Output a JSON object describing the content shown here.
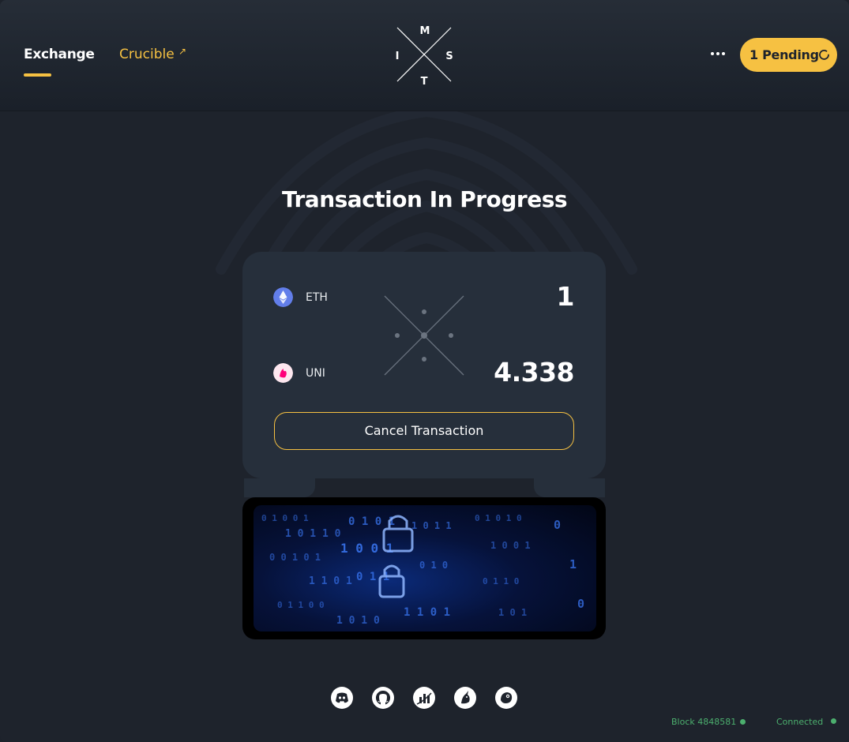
{
  "nav": {
    "exchange_label": "Exchange",
    "crucible_label": "Crucible",
    "crucible_ext_icon": "external-arrow-icon"
  },
  "logo": {
    "top": "M",
    "left": "I",
    "right": "S",
    "bottom": "T"
  },
  "header": {
    "more_icon": "ellipsis-icon",
    "pending_label": "1 Pending"
  },
  "main": {
    "title": "Transaction In Progress",
    "from_token": {
      "symbol": "ETH",
      "amount": "1",
      "icon": "eth-icon",
      "color": "#627eea"
    },
    "to_token": {
      "symbol": "UNI",
      "amount": "4.338",
      "icon": "uni-icon",
      "color": "#ff007a"
    },
    "cancel_label": "Cancel Transaction"
  },
  "social": [
    "discord-icon",
    "github-icon",
    "chart-icon",
    "unicorn-icon",
    "gecko-icon"
  ],
  "footer": {
    "block_label": "Block 4848581",
    "connected_label": "Connected"
  },
  "colors": {
    "accent": "#f6c142",
    "background": "#1e232c",
    "card": "#262f3b",
    "status": "#4caf6e"
  }
}
